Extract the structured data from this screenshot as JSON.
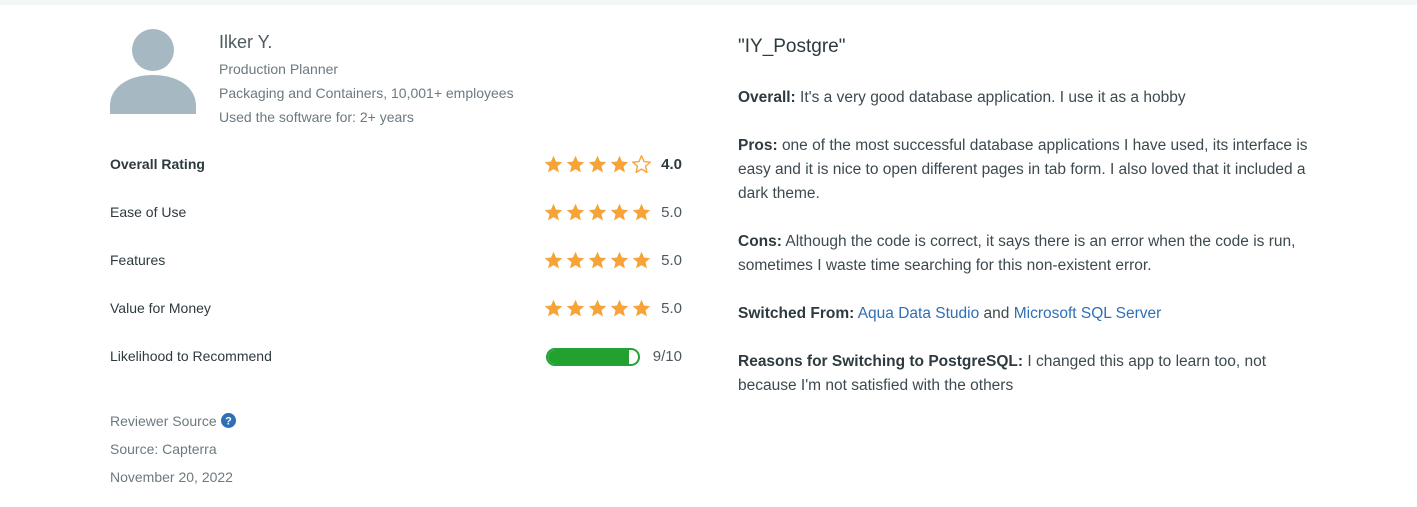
{
  "reviewer": {
    "name": "Ilker Y.",
    "job_title": "Production Planner",
    "company": "Packaging and Containers, 10,001+ employees",
    "usage": "Used the software for: 2+ years"
  },
  "ratings": [
    {
      "label": "Overall Rating",
      "value": "4.0",
      "stars": 4
    },
    {
      "label": "Ease of Use",
      "value": "5.0",
      "stars": 5
    },
    {
      "label": "Features",
      "value": "5.0",
      "stars": 5
    },
    {
      "label": "Value for Money",
      "value": "5.0",
      "stars": 5
    }
  ],
  "likelihood": {
    "label": "Likelihood to Recommend",
    "value": "9/10",
    "fraction": 0.9
  },
  "source": {
    "reviewer_source_label": "Reviewer Source",
    "source_text": "Source: Capterra",
    "date": "November 20, 2022"
  },
  "review": {
    "title": "\"IY_Postgre\"",
    "overall_label": "Overall:",
    "overall_text": "It's a very good database application. I use it as a hobby",
    "pros_label": "Pros:",
    "pros_text": "one of the most successful database applications I have used, its interface is easy and it is nice to open different pages in tab form. I also loved that it included a dark theme.",
    "cons_label": "Cons:",
    "cons_text": "Although the code is correct, it says there is an error when the code is run, sometimes I waste time searching for this non-existent error.",
    "switched_label": "Switched From:",
    "switched_from_1": "Aqua Data Studio",
    "switched_and": "and",
    "switched_from_2": "Microsoft SQL Server",
    "reasons_label": "Reasons for Switching to PostgreSQL:",
    "reasons_text": "I changed this app to learn too, not because I'm not satisfied with the others"
  },
  "colors": {
    "star": "#f7a335",
    "bar": "#23a12f",
    "link": "#2f6fb5",
    "avatar": "#a6b8c2"
  }
}
